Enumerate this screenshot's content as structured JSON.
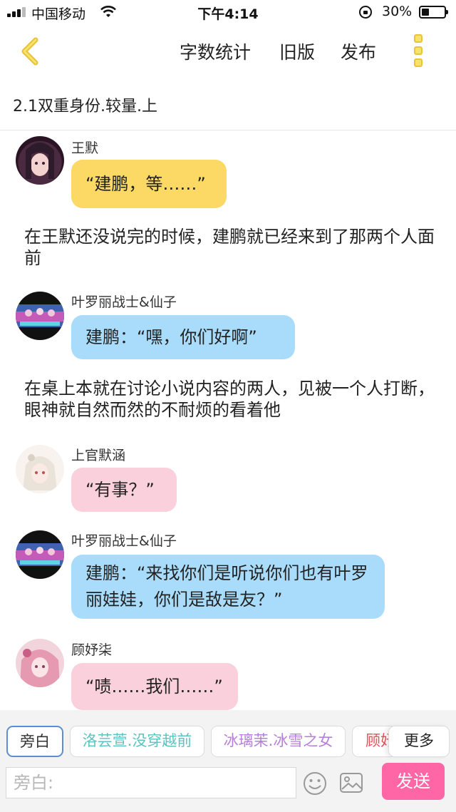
{
  "status_bar": {
    "carrier": "中国移动",
    "time": "下午4:14",
    "battery": "30%"
  },
  "nav": {
    "back_icon": "chevron-left-icon",
    "word_count": "字数统计",
    "old_version": "旧版",
    "publish": "发布",
    "more_icon": "more-vertical-icon",
    "accent_color": "#f2c930"
  },
  "chapter_title": "2.1双重身份.较量.上",
  "messages": [
    {
      "type": "dialog",
      "sender": "王默",
      "text": "“建鹏，等……”",
      "bubble_color": "#fbd964"
    },
    {
      "type": "narration",
      "text": "在王默还没说完的时候，建鹏就已经来到了那两个人面前"
    },
    {
      "type": "dialog",
      "sender": "叶罗丽战士&仙子",
      "text": "建鹏：“嘿，你们好啊”",
      "bubble_color": "#a9dcfb"
    },
    {
      "type": "narration",
      "text": "在桌上本就在讨论小说内容的两人，见被一个人打断，眼神就自然而然的不耐烦的看着他"
    },
    {
      "type": "dialog",
      "sender": "上官默涵",
      "text": "“有事？”",
      "bubble_color": "#fbd0dd"
    },
    {
      "type": "dialog",
      "sender": "叶罗丽战士&仙子",
      "text": "建鹏：“来找你们是听说你们也有叶罗丽娃娃，你们是敌是友？”",
      "bubble_color": "#a9dcfb"
    },
    {
      "type": "dialog",
      "sender": "顾妤柒",
      "text": "“啧……我们……”",
      "bubble_color": "#fbd0dd"
    }
  ],
  "roles": [
    {
      "label": "旁白",
      "color": "#333333",
      "selected": true
    },
    {
      "label": "洛芸萱.没穿越前",
      "color": "#5cc3c0"
    },
    {
      "label": "冰璃茉.冰雪之女",
      "color": "#b77fd8"
    },
    {
      "label": "顾妤",
      "color": "#e0525a"
    }
  ],
  "more_roles": "更多",
  "composer": {
    "placeholder": "旁白:",
    "emoji_icon": "smiley-icon",
    "image_icon": "image-icon",
    "send": "发送",
    "send_color": "#ff66a6"
  }
}
